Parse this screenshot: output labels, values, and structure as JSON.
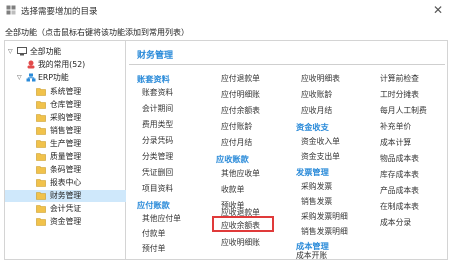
{
  "window": {
    "title": "选择需要增加的目录"
  },
  "hint": "全部功能（点击鼠标右键将该功能添加到常用列表）",
  "tree": {
    "root": "全部功能",
    "favorites": "我的常用(52)",
    "erp": "ERP功能",
    "items": [
      "系统管理",
      "仓库管理",
      "采购管理",
      "销售管理",
      "生产管理",
      "质量管理",
      "条码管理",
      "报表中心",
      "财务管理",
      "会计凭证",
      "资金管理"
    ],
    "selected": "财务管理"
  },
  "main": {
    "section_title": "财务管理",
    "col1": {
      "cat1": "账套资料",
      "cat1_items": [
        "账套资料",
        "会计期间",
        "费用类型",
        "分录凭码",
        "分类管理",
        "凭证删回",
        "项目资料"
      ],
      "cat2": "应付账款",
      "cat2_items": [
        "其他应付单",
        "付款单",
        "预付单"
      ]
    },
    "col2": {
      "top_items": [
        "应付退款单",
        "应付明细账",
        "应付余额表",
        "应付账龄",
        "应付月结"
      ],
      "cat": "应收账款",
      "cat_items": [
        "其他应收单",
        "收款单",
        "预收单",
        "应收退款单",
        "应收余额表",
        "应收明细账"
      ]
    },
    "col3": {
      "top_items": [
        "应收明细表",
        "应收账龄",
        "应收月结"
      ],
      "cat1": "资金收支",
      "cat1_items": [
        "资金收入单",
        "资金支出单"
      ],
      "cat2": "发票管理",
      "cat2_items": [
        "采购发票",
        "销售发票",
        "采购发票明细",
        "销售发票明细"
      ],
      "cat3": "成本管理",
      "cat3_items": [
        "成本开账"
      ]
    },
    "col4": {
      "items": [
        "计算前检查",
        "工时分摊表",
        "每月人工制费",
        "补充单价",
        "成本计算",
        "物品成本表",
        "库存成本表",
        "产品成本表",
        "在制成本表",
        "成本分录"
      ]
    }
  },
  "highlighted_item": "应收余额表"
}
